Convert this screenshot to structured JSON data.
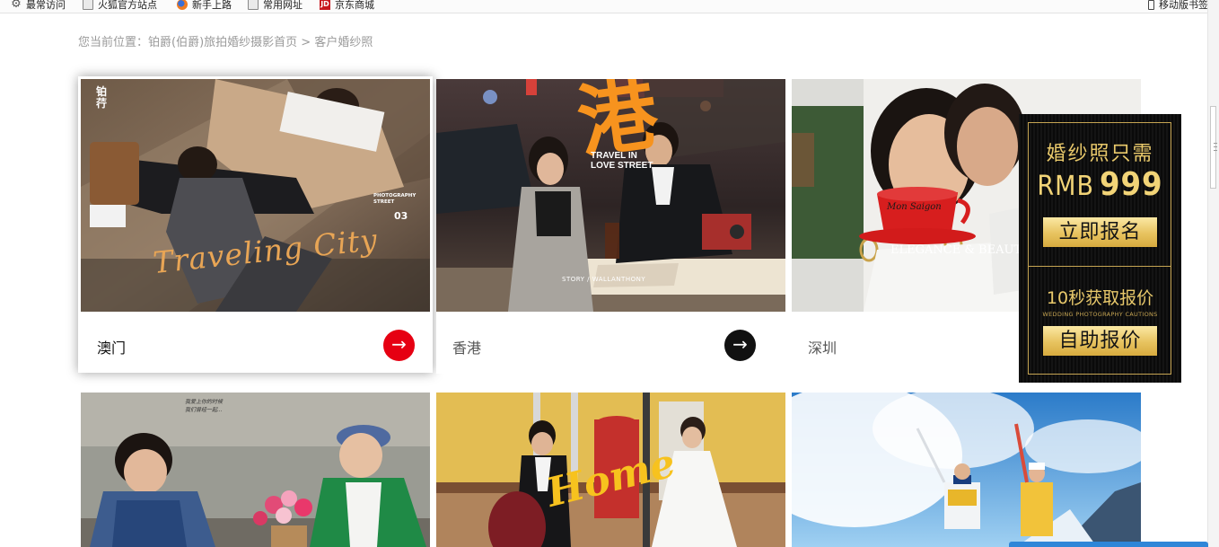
{
  "bookmarks": {
    "items": [
      {
        "label": "最常访问",
        "icon": "gear-icon"
      },
      {
        "label": "火狐官方站点",
        "icon": "folder-icon"
      },
      {
        "label": "新手上路",
        "icon": "firefox-icon"
      },
      {
        "label": "常用网址",
        "icon": "folder-icon"
      },
      {
        "label": "京东商城",
        "icon": "jd-icon",
        "icon_text": "JD"
      }
    ],
    "mobile": {
      "label": "移动版书签",
      "icon": "phone-icon"
    }
  },
  "breadcrumb": {
    "prefix": "您当前位置：",
    "home": "铂爵(伯爵)旅拍婚纱摄影首页",
    "separator": " > ",
    "current": "客户婚纱照"
  },
  "cards": [
    {
      "label": "澳门",
      "active": true,
      "arrow_color": "#e60012",
      "arrow_glyph": "→",
      "photo_texts": {
        "script": "Traveling City",
        "corner": "铂\n荇",
        "side_small": "PHOTOGRAPHY\nSTREET",
        "side_num": "03"
      }
    },
    {
      "label": "香港",
      "active": false,
      "arrow_color": "#111111",
      "arrow_glyph": "→",
      "photo_texts": {
        "big_char": "港",
        "title": "TRAVEL IN\nLOVE STREET",
        "caption": "STORY / WALLANTHONY"
      }
    },
    {
      "label": "深圳",
      "active": false,
      "photo_texts": {
        "cup": "Mon Saigon",
        "title": "ELEGANCE & BEAUT"
      }
    },
    {
      "label": "",
      "photo_texts": {
        "note": "我爱上你的时候\n我们曾经一起..."
      }
    },
    {
      "label": "",
      "photo_texts": {
        "script": "Home"
      }
    },
    {
      "label": "",
      "photo_texts": {}
    }
  ],
  "promo": {
    "title": "婚纱照只需",
    "currency": "RMB",
    "price": "999",
    "btn1": "立即报名",
    "sub": "10秒获取报价",
    "en": "WEDDING PHOTOGRAPHY CAUTIONS",
    "btn2": "自助报价",
    "gold": "#c5a452"
  },
  "colors": {
    "accent_red": "#e60012",
    "breadcrumb": "#9a9a9a"
  }
}
